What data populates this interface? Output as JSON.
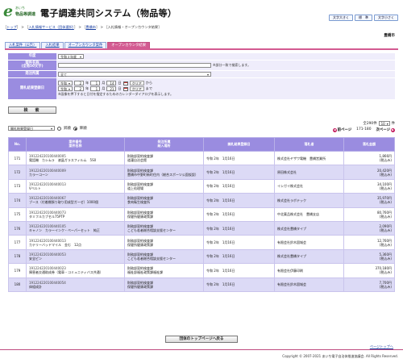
{
  "header": {
    "logo_letter": "e",
    "logo_sub1": "あいち",
    "logo_sub2": "物品等調達",
    "title": "電子調達共同システム（物品等）",
    "buttons": [
      "文字大きく",
      "標　準",
      "文字小さく"
    ]
  },
  "breadcrumb": {
    "items": [
      "トップ",
      "入札情報サービス（団体選択）",
      "豊橋市",
      "入札情報・オープンカウンタ結果"
    ],
    "prefix": "［",
    "sep": "］ > ［",
    "suffix": "］"
  },
  "org_name": "豊橋市",
  "tabs": [
    {
      "label": "入札案件（公告）",
      "active": false
    },
    {
      "label": "入札結果",
      "active": false
    },
    {
      "label": "オープンカウンタ案件",
      "active": false
    },
    {
      "label": "オープンカウンタ結果",
      "active": true
    }
  ],
  "form": {
    "year_label": "年度",
    "year_value": "令和３年度",
    "case_label": "案件名称\n(全角50文字)",
    "case_value": "",
    "case_note": "※部分一致で検索します。",
    "dept_label": "発注所属",
    "dept_value": "全て",
    "date_label": "開札結果登録日",
    "from": {
      "era": "令和",
      "y": "2",
      "m": "1",
      "d": "14",
      "clear": "クリア",
      "tail": "から"
    },
    "to": {
      "era": "令和",
      "y": "2",
      "m": "1",
      "d": "21",
      "clear": "クリア",
      "tail": "まで"
    },
    "yen": "年",
    "mon": "月",
    "day": "日",
    "cal_note": "※画像を押下すると日付を指定するためのカレンダーダイアログを表示します。",
    "search_button": "検　索"
  },
  "sort": {
    "select_value": "開札結果登録日",
    "asc": "昇順",
    "desc": "降順",
    "selected": "desc"
  },
  "pager": {
    "total": "全290件",
    "per_page": "10",
    "per_page_suffix": "件",
    "range": "171-180",
    "prev": "前ページ",
    "next": "次ページ"
  },
  "table": {
    "headers": {
      "no": "No.",
      "case": "案件番号\n案件名称",
      "dept": "発注所属\n納入場所",
      "date": "開札結果登録日",
      "vendor": "落札者",
      "amount": "落札金額"
    },
    "rows": [
      {
        "no": "171",
        "num": "191224220100440005",
        "name": "電話機　カシムラ　液晶ガラスフィルム　5S0",
        "dept": "財務部契約検査課",
        "place": "道灌自治会館",
        "date": "令和 2年　1月16日",
        "vendor": "株式会社ヤザワ電機　豊橋営業所",
        "amount": "1,866円",
        "tax": "(税込み)"
      },
      {
        "no": "172",
        "num": "191224220100440009",
        "name": "カラーコーン",
        "dept": "財務部契約検査課",
        "place": "豊橋市中野町新町住内（総合スポーツ公園仮設）",
        "date": "令和 2年　1月16日",
        "vendor": "原田株式会社",
        "amount": "20,420円",
        "tax": "(税込み)"
      },
      {
        "no": "173",
        "num": "191224220100440013",
        "name": "Vベルト",
        "dept": "財務部契約検査課",
        "place": "道上処理場",
        "date": "令和 2年　1月16日",
        "vendor": "イシガイ株式会社",
        "amount": "34,100円",
        "tax": "(税込み)"
      },
      {
        "no": "174",
        "num": "191224220100440067",
        "name": "ブース（付着棚張り取り用成型ガーゼ）1000個",
        "dept": "財務部契約検査課",
        "place": "食肉衛生検査所",
        "date": "令和 2年　1月16日",
        "vendor": "株式会社ラボテック",
        "amount": "35,970円",
        "tax": "(税込み)"
      },
      {
        "no": "175",
        "num": "191224220100440073",
        "name": "タミフルカプセル75PTP",
        "dept": "財務部契約検査課",
        "place": "保健所健康政策課",
        "date": "令和 2年　1月16日",
        "vendor": "中北薬品株式会社　豊橋支店",
        "amount": "80,760円",
        "tax": "(税込み)"
      },
      {
        "no": "176",
        "num": "191224220100440105",
        "name": "キャノン　カラーインク・ペーパーセット　純正",
        "dept": "財務部契約検査課",
        "place": "こども若者総合相談支援センター",
        "date": "令和 2年　1月16日",
        "vendor": "株式会社豊橋タイプ",
        "amount": "2,090円",
        "tax": "(税込み)"
      },
      {
        "no": "177",
        "num": "191224220100440013",
        "name": "カテリーバッドマイル　金む　12点",
        "dept": "財務部契約検査課",
        "place": "保健所健康政策課",
        "date": "令和 2年　1月16日",
        "vendor": "有限会社鈴木園城会",
        "amount": "12,760円",
        "tax": "(税込み)"
      },
      {
        "no": "178",
        "num": "191224220100440053",
        "name": "安全ピン",
        "dept": "財務部契約検査課",
        "place": "こども若者総合相談支援センター",
        "date": "令和 2年　1月16日",
        "vendor": "株式会社豊橋タイプ",
        "amount": "5,360円",
        "tax": "(税込み)"
      },
      {
        "no": "179",
        "num": "191224220100440023",
        "name": "障害者交通助成券（電車・コミュニティバス共通）",
        "dept": "財務部契約検査課",
        "place": "福祉部福祉政策課福祉課",
        "date": "令和 2年　1月16日",
        "vendor": "有限会社伊藤印刷",
        "amount": "370,180円",
        "tax": "(税込み)"
      },
      {
        "no": "180",
        "num": "191224220100440054",
        "name": "体組成計",
        "dept": "財務部契約検査課",
        "place": "保健所健康政策課",
        "date": "令和 2年　1月16日",
        "vendor": "有限会社鈴木園城会",
        "amount": "7,700円",
        "tax": "(税込み)"
      }
    ]
  },
  "back_button": "団体のトップページへ戻る",
  "page_top": "ページトップへ",
  "copyright": "Copyright © 2007-2021 あいち電子自治体推進協議会. All Rights Reserved."
}
